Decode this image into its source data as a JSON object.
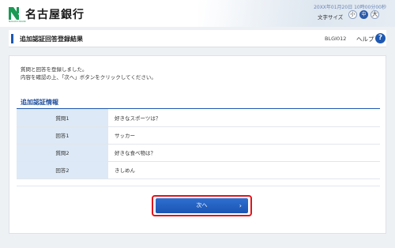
{
  "header": {
    "bank_name": "名古屋銀行",
    "logo_sub": "NAGOYA BANK",
    "datetime": "20XX年01月20日 10時00分00秒",
    "font_size_label": "文字サイズ",
    "font_sizes": [
      "小",
      "中",
      "大"
    ],
    "font_size_selected": "中"
  },
  "titlebar": {
    "title": "追加認証回答登録結果",
    "screen_id": "BLGI012",
    "help_label": "ヘルプ",
    "help_icon": "?"
  },
  "main": {
    "message_line1": "質問と回答を登録しました。",
    "message_line2": "内容を確認の上、「次へ」ボタンをクリックしてください。",
    "section_title": "追加認証情報",
    "rows": [
      {
        "label": "質問1",
        "value": "好きなスポーツは？"
      },
      {
        "label": "回答1",
        "value": "サッカー"
      },
      {
        "label": "質問2",
        "value": "好きな食べ物は？"
      },
      {
        "label": "回答2",
        "value": "きしめん"
      }
    ],
    "next_button_label": "次へ",
    "next_button_icon": "chevron-right-icon"
  },
  "colors": {
    "brand_green": "#1a9a55",
    "accent_blue": "#1e58b0",
    "highlight_red": "#e0141c",
    "label_cell_bg": "#dde9f6"
  }
}
